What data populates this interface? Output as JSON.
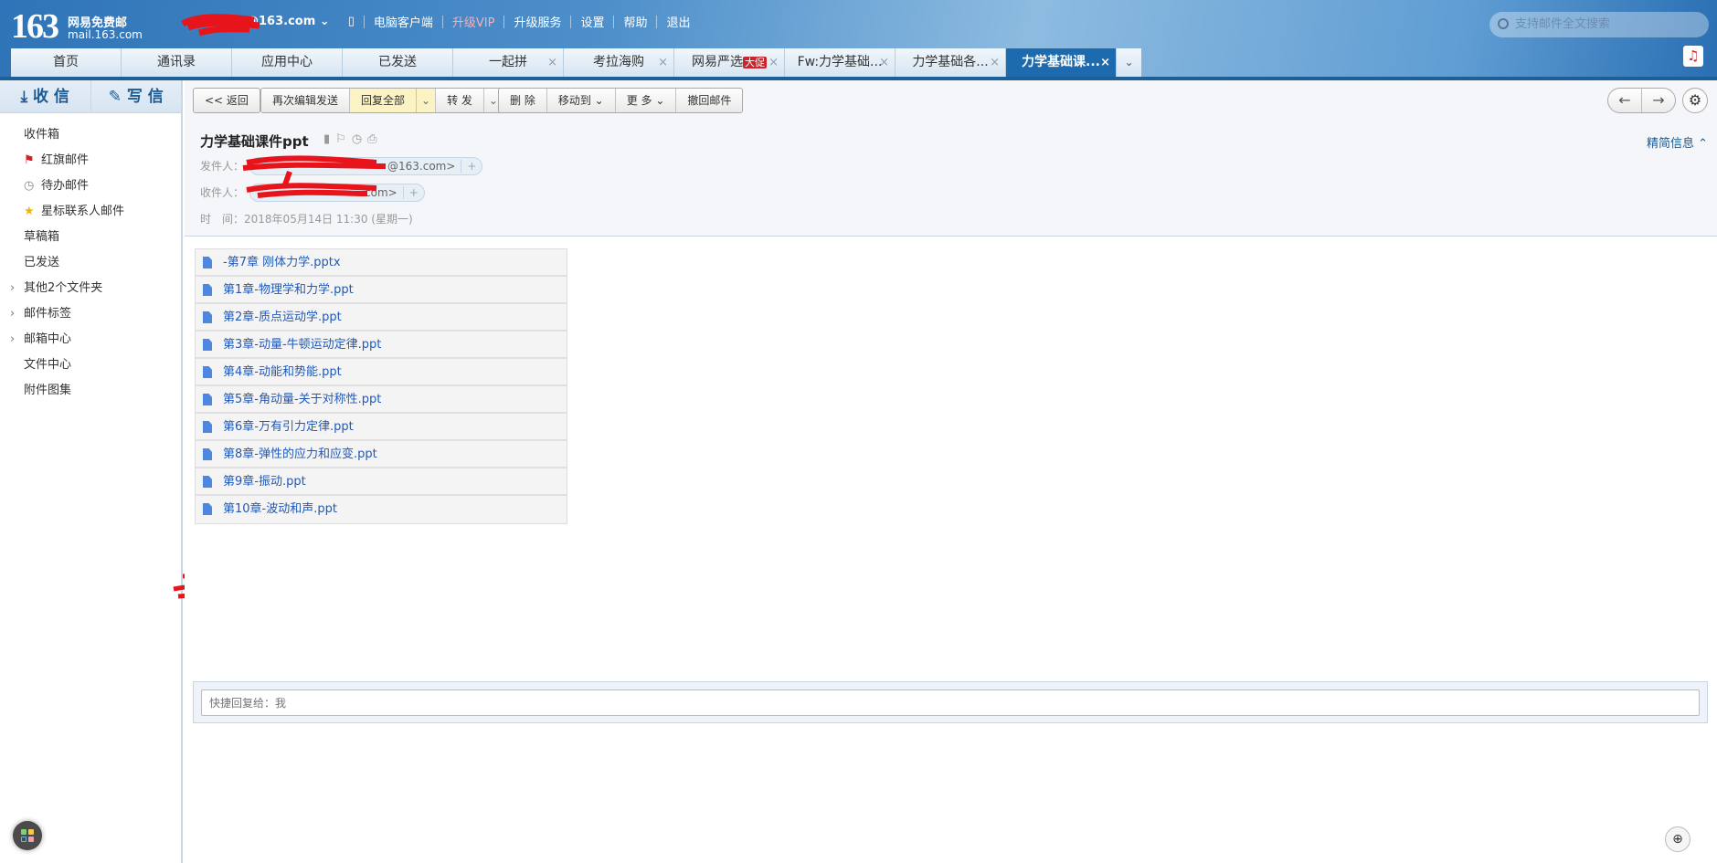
{
  "header": {
    "logo_number": "163",
    "logo_line1": "网易免费邮",
    "logo_line2": "mail.163.com",
    "account_visible": "@163.com",
    "nav": [
      "电脑客户端",
      "升级VIP",
      "升级服务",
      "设置",
      "帮助",
      "退出"
    ],
    "search_placeholder": "支持邮件全文搜索"
  },
  "tabs": [
    {
      "label": "首页"
    },
    {
      "label": "通讯录"
    },
    {
      "label": "应用中心"
    },
    {
      "label": "已发送"
    },
    {
      "label": "一起拼",
      "close": "×"
    },
    {
      "label": "考拉海购",
      "close": "×"
    },
    {
      "label": "网易严选",
      "badge": "大促",
      "close": "×"
    },
    {
      "label": "Fw:力学基础...",
      "close": "×"
    },
    {
      "label": "力学基础各...",
      "close": "×"
    },
    {
      "label": "力学基础课...",
      "close": "×",
      "active": true
    }
  ],
  "sidebar": {
    "receive": "收 信",
    "compose": "写 信",
    "items": [
      {
        "label": "收件箱"
      },
      {
        "label": "红旗邮件"
      },
      {
        "label": "待办邮件"
      },
      {
        "label": "星标联系人邮件"
      },
      {
        "label": "草稿箱"
      },
      {
        "label": "已发送"
      },
      {
        "label": "其他2个文件夹"
      },
      {
        "label": "邮件标签"
      },
      {
        "label": "邮箱中心"
      },
      {
        "label": "文件中心"
      },
      {
        "label": "附件图集"
      }
    ]
  },
  "toolbar": {
    "back": "<< 返回",
    "reedit": "再次编辑发送",
    "reply_all": "回复全部",
    "forward": "转 发",
    "delete": "删 除",
    "move_to": "移动到",
    "more": "更 多",
    "recall": "撤回邮件"
  },
  "mail": {
    "subject": "力学基础课件ppt",
    "brief": "精简信息",
    "sender_label": "发件人：",
    "sender_visible": "@163.com>",
    "recipient_label": "收件人：",
    "recipient_visible": "com>",
    "time_label": "时　间：",
    "time": "2018年05月14日 11:30 (星期一)"
  },
  "attachments": [
    "-第7章 刚体力学.pptx",
    "第1章-物理学和力学.ppt",
    "第2章-质点运动学.ppt",
    "第3章-动量-牛顿运动定律.ppt",
    "第4章-动能和势能.ppt",
    "第5章-角动量-关于对称性.ppt",
    "第6章-万有引力定律.ppt",
    "第8章-弹性的应力和应变.ppt",
    "第9章-振动.ppt",
    "第10章-波动和声.ppt"
  ],
  "quick_reply": {
    "placeholder": "快捷回复给：我"
  },
  "colors": {
    "header_blue": "#2f74b8",
    "active_tab": "#1d6aae",
    "link": "#2059b8",
    "vip": "#f7b0b8"
  }
}
